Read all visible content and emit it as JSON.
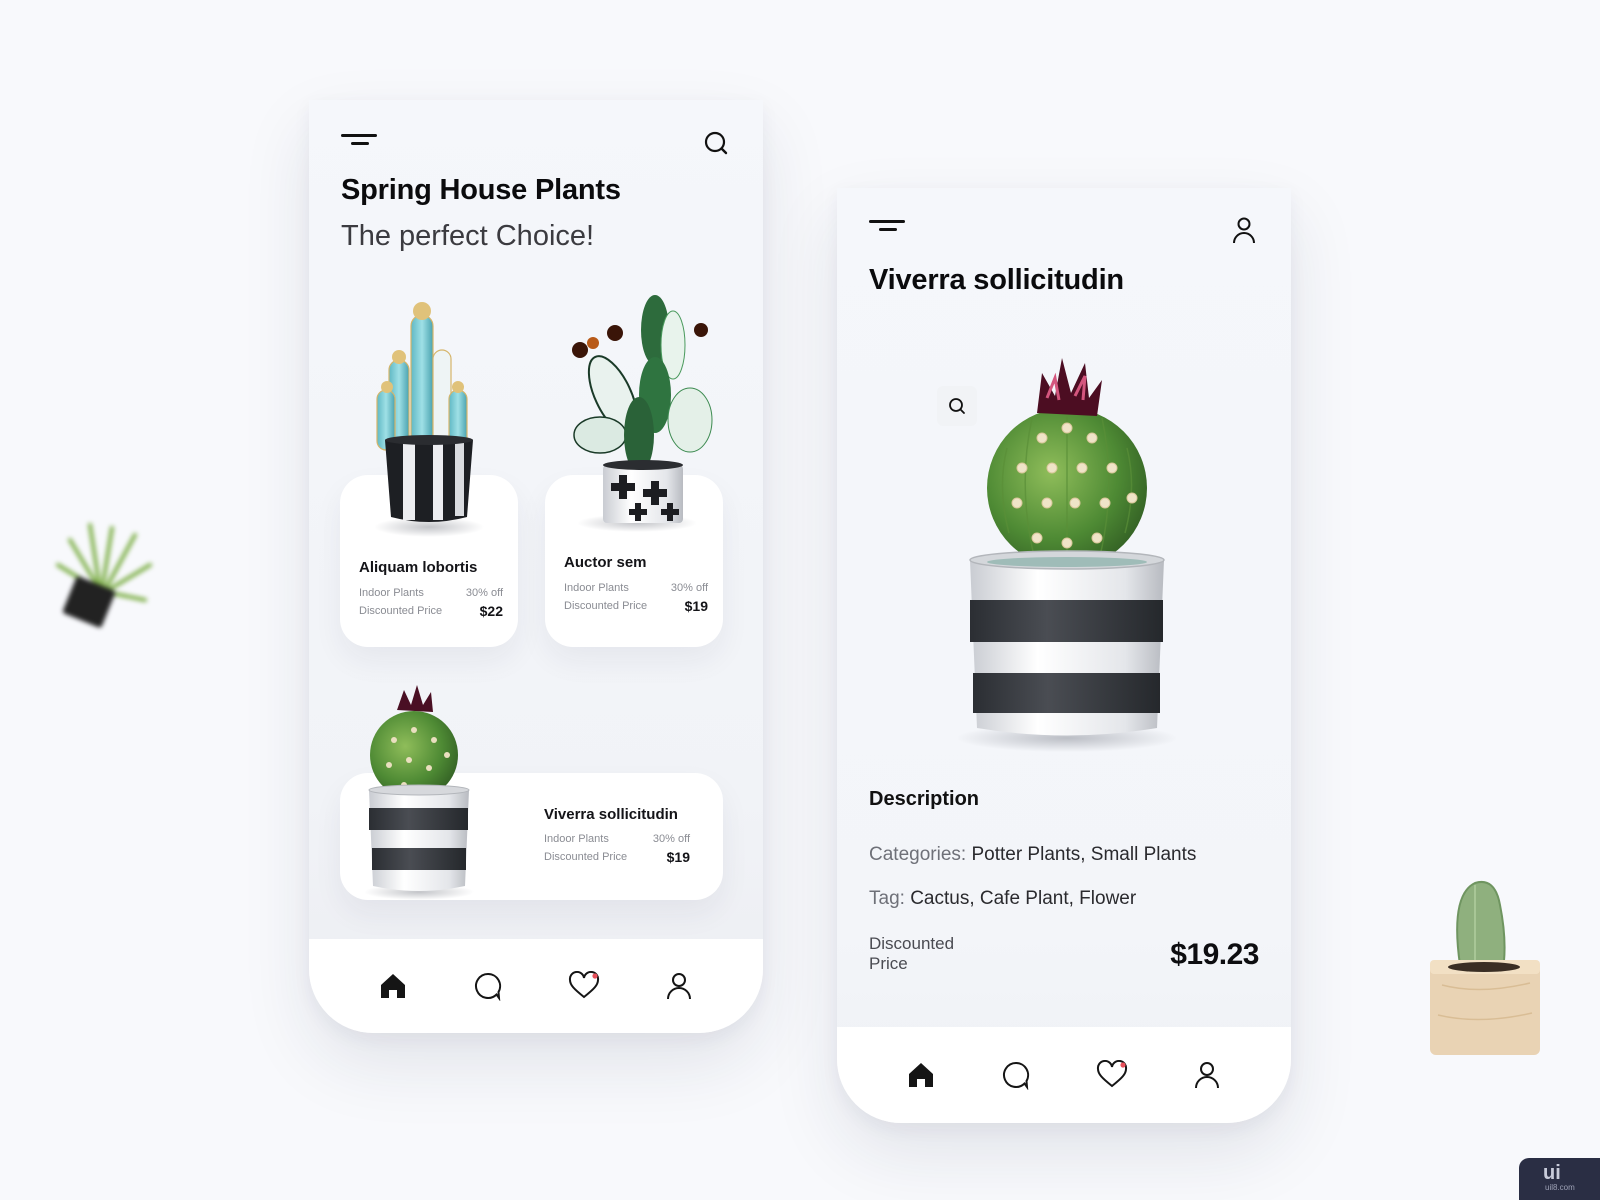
{
  "colors": {
    "background": "#f8f9fc",
    "text_primary": "#111111",
    "text_muted": "#8a8c93",
    "notification_dot": "#e8505b",
    "watermark_bg": "#2a2e44"
  },
  "left_screen": {
    "header": {
      "menu_icon": "menu-icon",
      "action_icon": "search-icon",
      "title": "Spring House Plants",
      "subtitle": "The perfect Choice!"
    },
    "products": [
      {
        "name": "Aliquam lobortis",
        "category": "Indoor Plants",
        "discount": "30% off",
        "price_label": "Discounted Price",
        "price": "$22",
        "image": "blue-cactus-in-striped-pot"
      },
      {
        "name": "Auctor sem",
        "category": "Indoor Plants",
        "discount": "30% off",
        "price_label": "Discounted Price",
        "price": "$19",
        "image": "prickly-pear-in-cross-pot"
      },
      {
        "name": "Viverra sollicitudin",
        "category": "Indoor Plants",
        "discount": "30% off",
        "price_label": "Discounted Price",
        "price": "$19",
        "image": "barrel-cactus-in-striped-pot"
      }
    ],
    "bottom_nav": [
      {
        "icon": "home-icon",
        "active": true
      },
      {
        "icon": "chat-icon",
        "active": false
      },
      {
        "icon": "heart-icon",
        "active": false,
        "badge": true
      },
      {
        "icon": "user-icon",
        "active": false
      }
    ]
  },
  "right_screen": {
    "header": {
      "menu_icon": "menu-icon",
      "action_icon": "user-icon",
      "title": "Viverra sollicitudin"
    },
    "image": "barrel-cactus-in-striped-pot",
    "zoom_icon": "search-icon",
    "description": {
      "title": "Description",
      "categories_label": "Categories:",
      "categories_value": "Potter Plants, Small Plants",
      "tag_label": "Tag:",
      "tag_value": "Cactus, Cafe Plant, Flower",
      "price_label": "Discounted Price",
      "price": "$19.23"
    },
    "bottom_nav": [
      {
        "icon": "home-icon",
        "active": true
      },
      {
        "icon": "chat-icon",
        "active": false
      },
      {
        "icon": "heart-icon",
        "active": false,
        "badge": true
      },
      {
        "icon": "user-icon",
        "active": false
      }
    ]
  },
  "decorations": {
    "left": "blurred-plant-in-black-pot",
    "right": "cactus-in-wooden-pot"
  },
  "watermark": {
    "text": "ui",
    "subtext": "uil8.com"
  }
}
